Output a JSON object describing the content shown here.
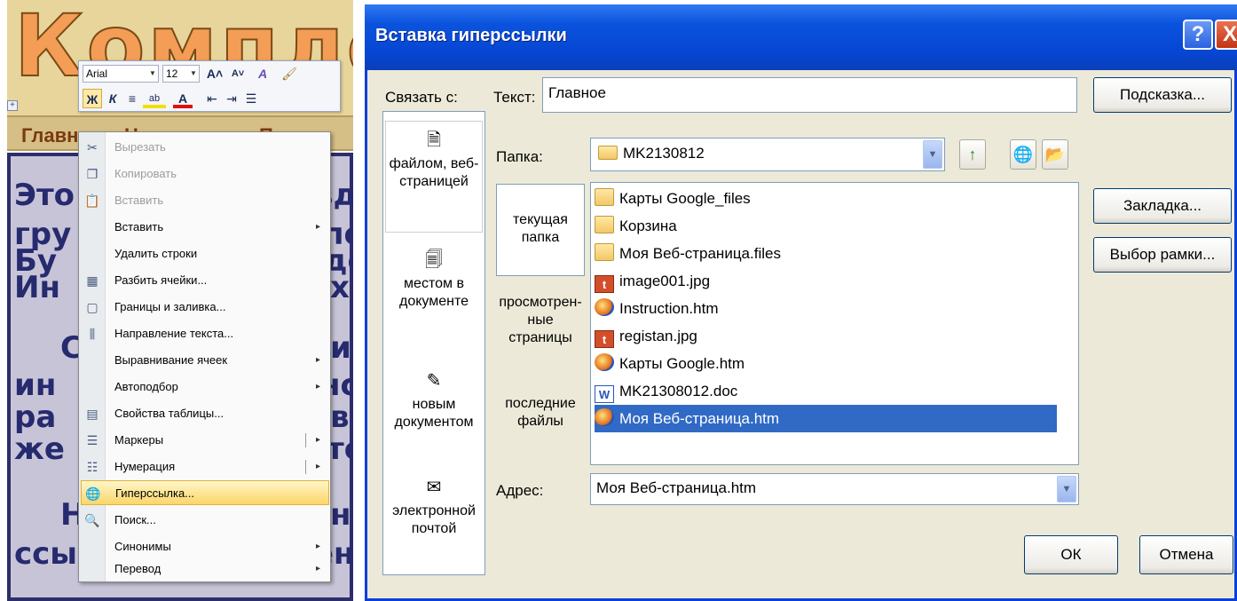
{
  "document": {
    "banner_title": "Комплекс",
    "nav": [
      "Главное",
      "Новости",
      "Погода"
    ],
    "body_lines": [
      "Это",
      "вд",
      "гру",
      "по",
      "Бу",
      "до",
      "Ин",
      "х",
      "С",
      "и",
      "ин",
      "нс",
      "ра",
      "в",
      "же",
      "то",
      "Н",
      "н",
      "ссылки на документ"
    ]
  },
  "mini_toolbar": {
    "font_name": "Arial",
    "font_size": "12",
    "grow_font": "A˄",
    "shrink_font": "A˅",
    "styles": "A",
    "bold": "Ж",
    "italic": "К",
    "center": "≡",
    "highlight": "ab",
    "font_color": "A",
    "indent_dec": "⇤",
    "indent_inc": "⇥",
    "bullets": "☰"
  },
  "context_menu": {
    "items": [
      {
        "label": "Вырезать",
        "icon": "scissors-icon",
        "glyph": "✂",
        "disabled": true
      },
      {
        "label": "Копировать",
        "icon": "copy-icon",
        "glyph": "❐",
        "disabled": true
      },
      {
        "label": "Вставить",
        "icon": "paste-icon",
        "glyph": "📋",
        "disabled": true
      },
      {
        "label": "Вставить",
        "icon": "",
        "glyph": "",
        "submenu": true
      },
      {
        "label": "Удалить строки",
        "icon": "",
        "glyph": ""
      },
      {
        "label": "Разбить ячейки...",
        "icon": "split-cells-icon",
        "glyph": "▦"
      },
      {
        "label": "Границы и заливка...",
        "icon": "borders-icon",
        "glyph": "▢"
      },
      {
        "label": "Направление текста...",
        "icon": "text-direction-icon",
        "glyph": "⫼"
      },
      {
        "label": "Выравнивание ячеек",
        "icon": "",
        "glyph": "",
        "submenu": true
      },
      {
        "label": "Автоподбор",
        "icon": "",
        "glyph": "",
        "submenu": true
      },
      {
        "label": "Свойства таблицы...",
        "icon": "table-properties-icon",
        "glyph": "▤"
      },
      {
        "label": "Маркеры",
        "icon": "bullets-icon",
        "glyph": "☰",
        "submenu": true,
        "split": true
      },
      {
        "label": "Нумерация",
        "icon": "numbering-icon",
        "glyph": "☷",
        "submenu": true,
        "split": true
      },
      {
        "label": "Гиперссылка...",
        "icon": "hyperlink-icon",
        "glyph": "🌐",
        "highlighted": true
      },
      {
        "label": "Поиск...",
        "icon": "search-icon",
        "glyph": "🔍"
      },
      {
        "label": "Синонимы",
        "icon": "",
        "glyph": "",
        "submenu": true
      },
      {
        "label": "Перевод",
        "icon": "",
        "glyph": "",
        "submenu": true
      }
    ],
    "submenu_arrow": "▸"
  },
  "dialog": {
    "title": "Вставка гиперссылки",
    "help_glyph": "?",
    "close_glyph": "X",
    "link_to_label": "Связать с:",
    "text_label": "Текст:",
    "text_value": "Главное",
    "screentip_button": "Подсказка...",
    "folder_label": "Папка:",
    "folder_value": "MK2130812",
    "link_targets": [
      {
        "label": "файлом, веб-страницей",
        "icon": "file-web-icon",
        "glyph": "🗎",
        "selected": true
      },
      {
        "label": "местом в документе",
        "icon": "place-in-document-icon",
        "glyph": "🗐"
      },
      {
        "label": "новым документом",
        "icon": "new-document-icon",
        "glyph": "✎"
      },
      {
        "label": "электронной почтой",
        "icon": "email-icon",
        "glyph": "✉"
      }
    ],
    "sub_nav": [
      {
        "label": "текущая папка",
        "selected": true
      },
      {
        "label": "просмотрен-ные страницы"
      },
      {
        "label": "последние файлы"
      }
    ],
    "files": [
      {
        "name": "Карты Google_files",
        "type": "folder",
        "glyph": ""
      },
      {
        "name": "Корзина",
        "type": "folder",
        "glyph": ""
      },
      {
        "name": "Моя Веб-страница.files",
        "type": "folder",
        "glyph": ""
      },
      {
        "name": "image001.jpg",
        "type": "image",
        "glyph": "t"
      },
      {
        "name": "Instruction.htm",
        "type": "html",
        "glyph": ""
      },
      {
        "name": "registan.jpg",
        "type": "image",
        "glyph": "t"
      },
      {
        "name": "Карты Google.htm",
        "type": "html",
        "glyph": ""
      },
      {
        "name": "MK21308012.doc",
        "type": "doc",
        "glyph": "W"
      },
      {
        "name": "Моя Веб-страница.htm",
        "type": "html",
        "glyph": "",
        "selected": true
      }
    ],
    "bookmark_button": "Закладка...",
    "frame_button": "Выбор рамки...",
    "address_label": "Адрес:",
    "address_value": "Моя Веб-страница.htm",
    "ok_button": "ОК",
    "cancel_button": "Отмена",
    "dropdown_glyph": "▼",
    "scroll_up_glyph": "▲",
    "scroll_down_glyph": "▼",
    "folder_up_glyph": "↑",
    "browse_web_glyph": "🌐",
    "browse_file_glyph": "📂"
  },
  "colors": {
    "title_bar": "#0a52dd",
    "selection": "#316ac5",
    "banner_text": "#f39d57",
    "doc_text": "#262a6e"
  }
}
